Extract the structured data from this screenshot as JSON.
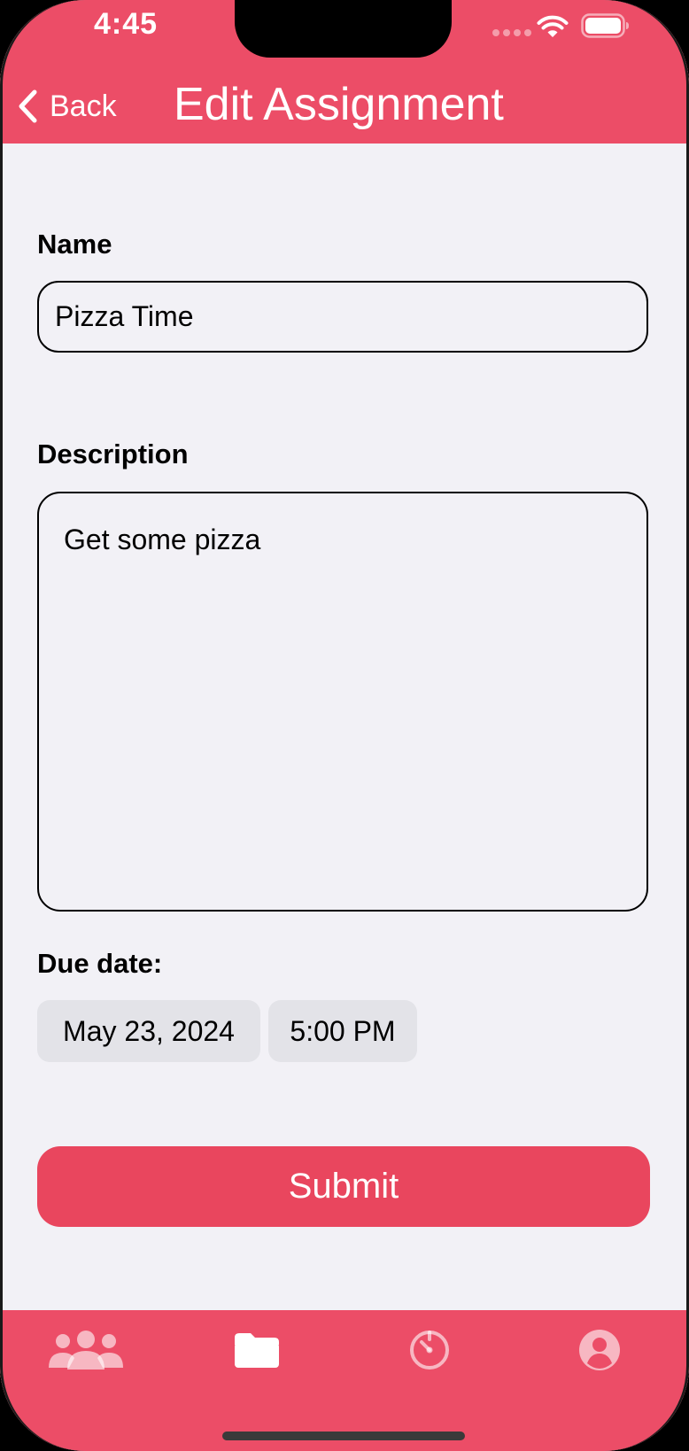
{
  "status_bar": {
    "time": "4:45"
  },
  "header": {
    "back_label": "Back",
    "title": "Edit Assignment"
  },
  "form": {
    "name_label": "Name",
    "name_value": "Pizza Time",
    "description_label": "Description",
    "description_value": "Get some pizza",
    "due_label": "Due date:",
    "due_date": "May 23, 2024",
    "due_time": "5:00 PM",
    "submit_label": "Submit"
  },
  "tab_bar": {
    "items": [
      {
        "icon": "people-icon",
        "active": false
      },
      {
        "icon": "folder-icon",
        "active": true
      },
      {
        "icon": "timer-icon",
        "active": false
      },
      {
        "icon": "profile-icon",
        "active": false
      }
    ]
  },
  "colors": {
    "brand": "#ec4d67",
    "submit": "#e9465e",
    "background": "#f2f1f6",
    "pill": "#e3e3e8"
  }
}
